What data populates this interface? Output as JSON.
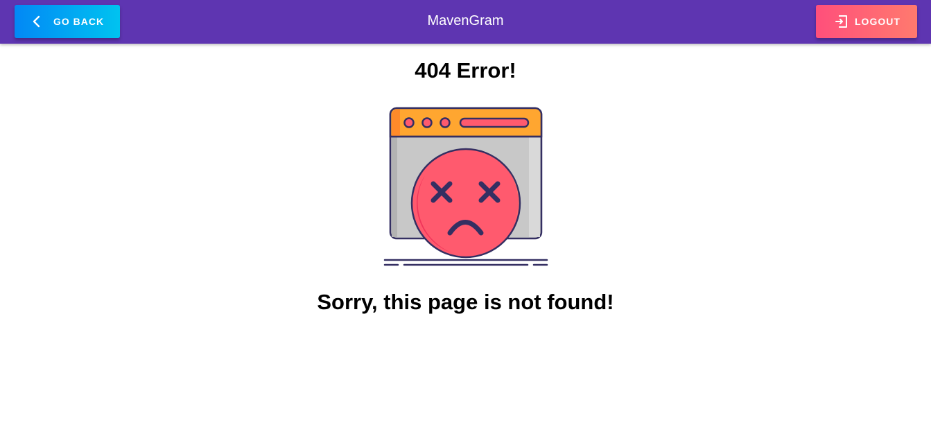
{
  "header": {
    "back_label": "Go Back",
    "title": "MavenGram",
    "logout_label": "Logout"
  },
  "main": {
    "error_title": "404 Error!",
    "message": "Sorry, this page is not found!",
    "illustration_icon": "sad-browser-window-icon"
  },
  "colors": {
    "appbar": "#5e35b1",
    "back_button_start": "#0288f5",
    "back_button_end": "#00c3f0",
    "logout_button_start": "#ff4f7b",
    "logout_button_end": "#ff7a6e",
    "face": "#ff5a6e",
    "window_header": "#ffa630",
    "window_body": "#c8c8c8",
    "outline": "#342f62"
  }
}
